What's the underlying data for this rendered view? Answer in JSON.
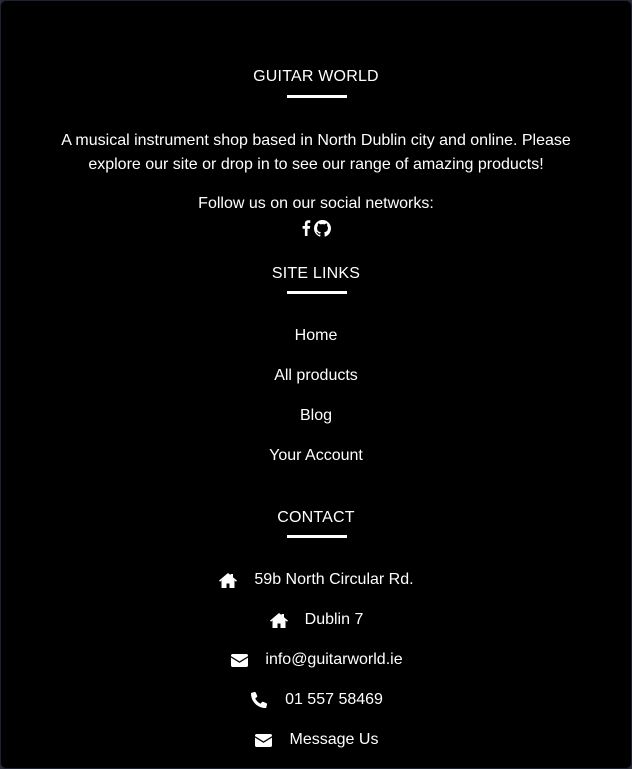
{
  "brand": {
    "title": "GUITAR WORLD",
    "description": "A musical instrument shop based in North Dublin city and online. Please explore our site or drop in to see our range of amazing products!",
    "follow_text": "Follow us on our social networks:",
    "social": [
      {
        "icon": "facebook-icon"
      },
      {
        "icon": "github-icon"
      }
    ]
  },
  "site_links": {
    "title": "SITE LINKS",
    "items": [
      {
        "label": "Home"
      },
      {
        "label": "All products"
      },
      {
        "label": "Blog"
      },
      {
        "label": "Your Account"
      }
    ]
  },
  "contact": {
    "title": "CONTACT",
    "items": [
      {
        "icon": "home-icon",
        "text": "59b North Circular Rd."
      },
      {
        "icon": "home-icon",
        "text": "Dublin 7"
      },
      {
        "icon": "envelope-icon",
        "text": "info@guitarworld.ie"
      },
      {
        "icon": "phone-icon",
        "text": "01 557 58469"
      },
      {
        "icon": "envelope-icon",
        "text": "Message Us"
      }
    ]
  },
  "colors": {
    "background": "#000000",
    "text": "#ffffff"
  }
}
